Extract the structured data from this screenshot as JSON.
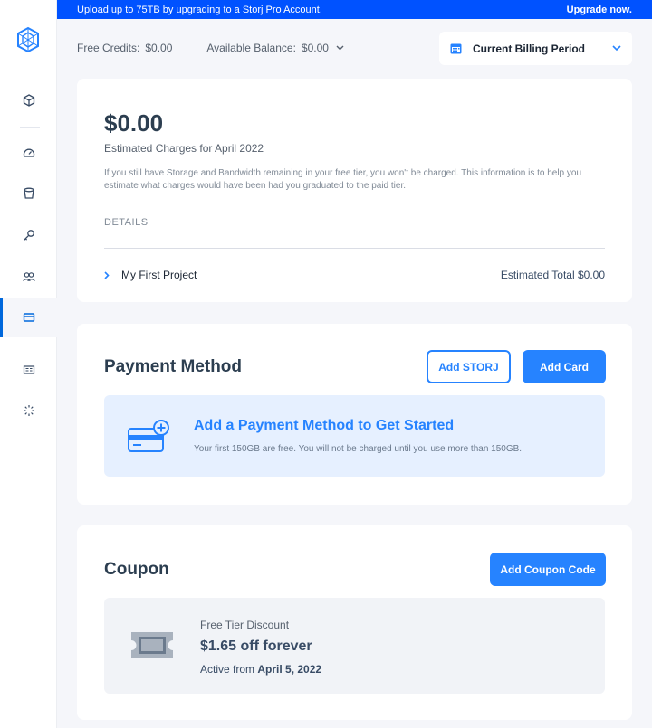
{
  "banner": {
    "text": "Upload up to 75TB by upgrading to a Storj Pro Account.",
    "cta": "Upgrade now."
  },
  "topbar": {
    "credits_label": "Free Credits:",
    "credits_value": "$0.00",
    "balance_label": "Available Balance:",
    "balance_value": "$0.00",
    "period": "Current Billing Period"
  },
  "summary": {
    "amount": "$0.00",
    "estimated_label": "Estimated Charges for April 2022",
    "info": "If you still have Storage and Bandwidth remaining in your free tier, you won't be charged. This information is to help you estimate what charges would have been had you graduated to the paid tier.",
    "details_label": "DETAILS",
    "project_name": "My First Project",
    "project_total": "Estimated Total $0.00"
  },
  "payment": {
    "title": "Payment Method",
    "add_storj": "Add STORJ",
    "add_card": "Add Card",
    "empty_title": "Add a Payment Method to Get Started",
    "empty_sub": "Your first 150GB are free. You will not be charged until you use more than 150GB."
  },
  "coupon": {
    "title": "Coupon",
    "add_button": "Add Coupon Code",
    "name": "Free Tier Discount",
    "value": "$1.65 off forever",
    "active_prefix": "Active from",
    "active_date": "April 5, 2022"
  },
  "sidebar": {
    "items": [
      "box-icon",
      "dashboard-icon",
      "bucket-icon",
      "key-icon",
      "users-icon",
      "billing-icon",
      "resources-icon",
      "spinner-icon"
    ],
    "active": "billing-icon"
  },
  "colors": {
    "accent": "#2683ff",
    "banner": "#0052ff"
  }
}
